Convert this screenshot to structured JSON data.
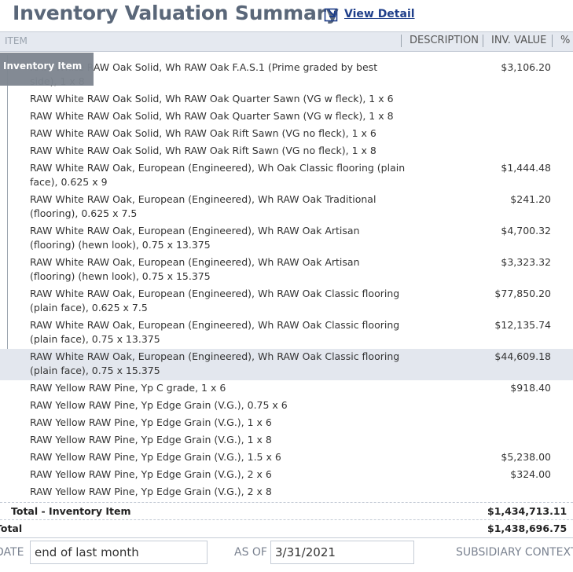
{
  "header": {
    "title": "Inventory Valuation Summary",
    "view_detail": "View Detail"
  },
  "tooltip": "Inventory Item",
  "columns": {
    "item_ghost": "ITEM",
    "description": "DESCRIPTION",
    "inv_value": "INV. VALUE",
    "pct": "% OF"
  },
  "rows": [
    {
      "item": "RAW White RAW Oak Solid, Wh RAW Oak F.A.S.1 (Prime graded by best side), 1 x 8",
      "value": "$3,106.20"
    },
    {
      "item": "RAW White RAW Oak Solid, Wh RAW Oak Quarter Sawn (VG w fleck), 1 x 6",
      "value": ""
    },
    {
      "item": "RAW White RAW Oak Solid, Wh RAW Oak Quarter Sawn (VG w fleck), 1 x 8",
      "value": ""
    },
    {
      "item": "RAW White RAW Oak Solid, Wh RAW Oak Rift Sawn (VG no fleck), 1 x 6",
      "value": ""
    },
    {
      "item": "RAW White RAW Oak Solid, Wh RAW Oak Rift Sawn (VG no fleck), 1 x 8",
      "value": ""
    },
    {
      "item": "RAW White RAW Oak, European (Engineered), Wh Oak Classic flooring (plain face), 0.625 x 9",
      "value": "$1,444.48"
    },
    {
      "item": "RAW White RAW Oak, European (Engineered), Wh RAW Oak Traditional (flooring), 0.625 x 7.5",
      "value": "$241.20"
    },
    {
      "item": "RAW White RAW Oak, European (Engineered), Wh RAW Oak  Artisan (flooring) (hewn look), 0.75 x 13.375",
      "value": "$4,700.32"
    },
    {
      "item": "RAW White RAW Oak, European (Engineered), Wh RAW Oak  Artisan (flooring) (hewn look), 0.75 x 15.375",
      "value": "$3,323.32"
    },
    {
      "item": "RAW White RAW Oak, European (Engineered), Wh RAW Oak  Classic flooring (plain face), 0.625 x 7.5",
      "value": "$77,850.20"
    },
    {
      "item": "RAW White RAW Oak, European (Engineered), Wh RAW Oak  Classic flooring (plain face), 0.75 x 13.375",
      "value": "$12,135.74"
    },
    {
      "item": "RAW White RAW Oak, European (Engineered), Wh RAW Oak  Classic flooring (plain face), 0.75 x 15.375",
      "value": "$44,609.18"
    },
    {
      "item": "RAW Yellow RAW Pine, Yp C grade, 1 x 6",
      "value": "$918.40"
    },
    {
      "item": "RAW Yellow RAW Pine, Yp Edge Grain (V.G.), 0.75 x 6",
      "value": ""
    },
    {
      "item": "RAW Yellow RAW Pine, Yp Edge Grain (V.G.), 1 x 6",
      "value": ""
    },
    {
      "item": "RAW Yellow RAW Pine, Yp Edge Grain (V.G.), 1 x 8",
      "value": ""
    },
    {
      "item": "RAW Yellow RAW Pine, Yp Edge Grain (V.G.), 1.5 x 6",
      "value": "$5,238.00"
    },
    {
      "item": "RAW Yellow RAW Pine, Yp Edge Grain (V.G.), 2 x 6",
      "value": "$324.00"
    },
    {
      "item": "RAW Yellow RAW Pine, Yp Edge Grain (V.G.), 2 x 8",
      "value": ""
    }
  ],
  "totals": {
    "inventory_label": "Total - Inventory Item",
    "inventory_value": "$1,434,713.11",
    "grand_label": "Total",
    "grand_value": "$1,438,696.75"
  },
  "filters": {
    "date_label": "DATE",
    "date_value": "end of last month",
    "as_of_label": "AS OF",
    "as_of_value": "3/31/2021",
    "subsidiary_label": "SUBSIDIARY CONTEXT"
  },
  "colors": {
    "title": "#5a6779",
    "link": "#1f3f8a",
    "header_bg": "#e5e9f0",
    "selected_row": "#e3e7ee",
    "tooltip_bg": "#7e8690"
  }
}
